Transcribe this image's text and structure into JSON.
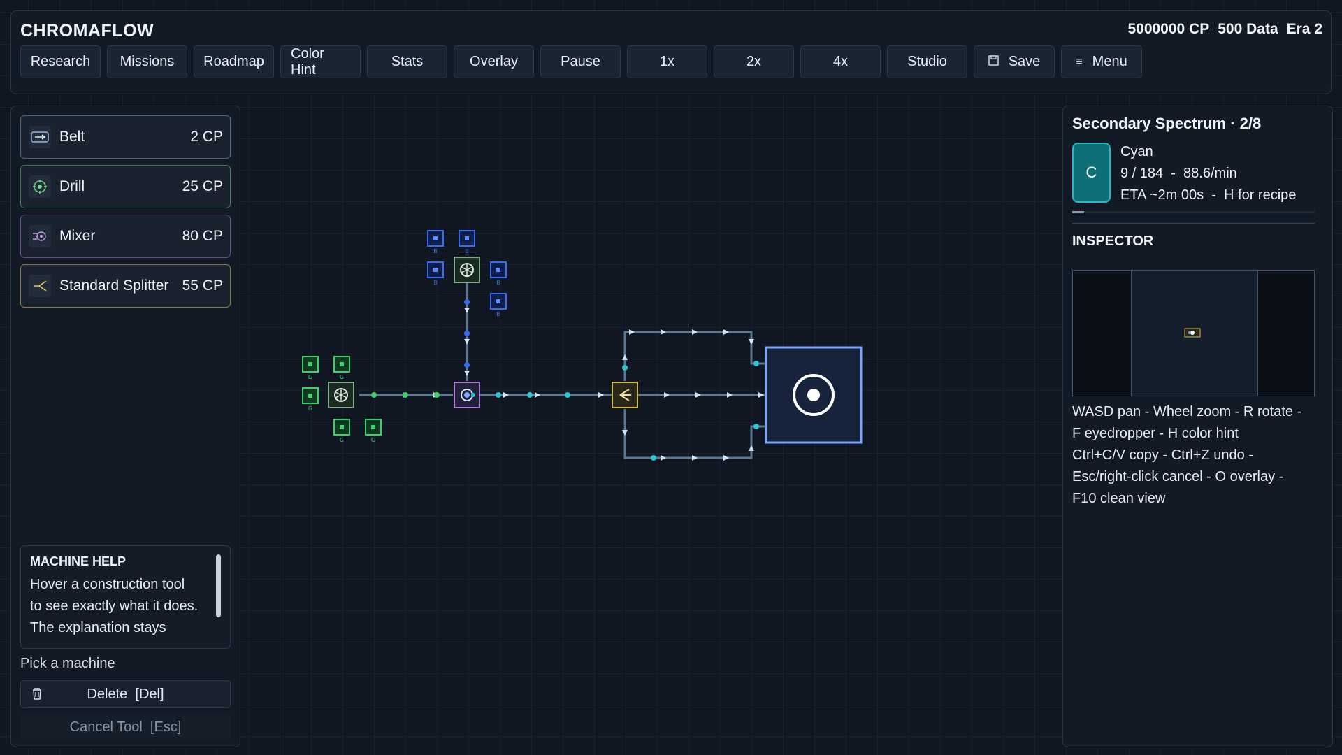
{
  "app": {
    "title": "CHROMAFLOW"
  },
  "resources": {
    "cp": "5000000 CP",
    "data": "500 Data",
    "era": "Era 2"
  },
  "toolbar": [
    {
      "label": "Research"
    },
    {
      "label": "Missions"
    },
    {
      "label": "Roadmap"
    },
    {
      "label": "Color Hint"
    },
    {
      "label": "Stats"
    },
    {
      "label": "Overlay"
    },
    {
      "label": "Pause"
    },
    {
      "label": "1x"
    },
    {
      "label": "2x"
    },
    {
      "label": "4x"
    },
    {
      "label": "Studio"
    }
  ],
  "save_label": "Save",
  "menu_label": "Menu",
  "tools": [
    {
      "name": "Belt",
      "cost": "2 CP",
      "color": "#55657c"
    },
    {
      "name": "Drill",
      "cost": "25 CP",
      "color": "#3c7f52"
    },
    {
      "name": "Mixer",
      "cost": "80 CP",
      "color": "#6a4a86"
    },
    {
      "name": "Standard Splitter",
      "cost": "55 CP",
      "color": "#8a7a3a"
    }
  ],
  "help": {
    "title": "MACHINE HELP",
    "lines": [
      "Hover a construction tool",
      "to see exactly what it does.",
      "The explanation stays"
    ]
  },
  "pick_label": "Pick a machine",
  "delete_label": "Delete  [Del]",
  "cancel_label": "Cancel Tool  [Esc]",
  "spectrum": {
    "title": "Secondary Spectrum · 2/8",
    "letter": "C",
    "color_name": "Cyan",
    "count_rate": "9 / 184  -  88.6/min",
    "eta": "ETA ~2m 00s  -  H for recipe",
    "progress": 0.049,
    "tile_color": "#0e6f78"
  },
  "inspector": {
    "title": "INSPECTOR"
  },
  "controls": [
    "WASD pan - Wheel zoom - R rotate -",
    "F eyedropper - H color hint",
    "Ctrl+C/V copy - Ctrl+Z undo -",
    "Esc/right-click cancel - O overlay -",
    "F10 clean view"
  ],
  "node_labels": {
    "blue": "B",
    "green": "G"
  },
  "colors": {
    "accent": "#29b8c4",
    "green_node": "#3ad06a",
    "blue_node": "#3a6cf0",
    "hub": "#7aa6ff"
  }
}
